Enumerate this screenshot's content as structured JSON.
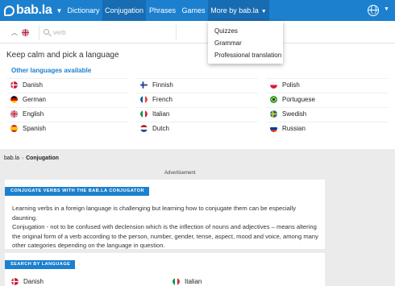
{
  "nav": {
    "logo": "bab.la",
    "links": [
      {
        "label": "Dictionary"
      },
      {
        "label": "Conjugation"
      },
      {
        "label": "Phrases"
      },
      {
        "label": "Games"
      },
      {
        "label": "More by bab.la"
      }
    ],
    "more_dropdown": [
      "Quizzes",
      "Grammar",
      "Professional translation"
    ]
  },
  "search": {
    "placeholder": "verb"
  },
  "language_picker": {
    "title": "Keep calm and pick a language",
    "other_label": "Other languages available",
    "languages": [
      {
        "name": "Danish"
      },
      {
        "name": "Finnish"
      },
      {
        "name": "Polish"
      },
      {
        "name": "German"
      },
      {
        "name": "French"
      },
      {
        "name": "Portuguese"
      },
      {
        "name": "English"
      },
      {
        "name": "Italian"
      },
      {
        "name": "Swedish"
      },
      {
        "name": "Spanish"
      },
      {
        "name": "Dutch"
      },
      {
        "name": "Russian"
      }
    ]
  },
  "breadcrumb": {
    "home": "bab.la",
    "current": "Conjugation"
  },
  "advertisement_label": "Advertisement",
  "conjugator_card": {
    "title": "CONJUGATE VERBS WITH THE BAB.LA CONJUGATOR",
    "lines": [
      "Learning verbs in a foreign language is challenging but learning how to conjugate them can be especially daunting.",
      "Conjugation - not to be confused with declension which is the inflection of nouns and adjectives – means altering",
      "the original form of a verb according to the person, number, gender, tense, aspect, mood and voice, among many",
      "other categories depending on the language in question."
    ]
  },
  "search_by_language_card": {
    "title": "SEARCH BY LANGUAGE",
    "languages": [
      {
        "name": "Danish"
      },
      {
        "name": "Italian"
      }
    ]
  },
  "colors": {
    "brand_blue": "#1c80cf",
    "nav_active": "#176cb2",
    "page_bg": "#ebebeb"
  }
}
